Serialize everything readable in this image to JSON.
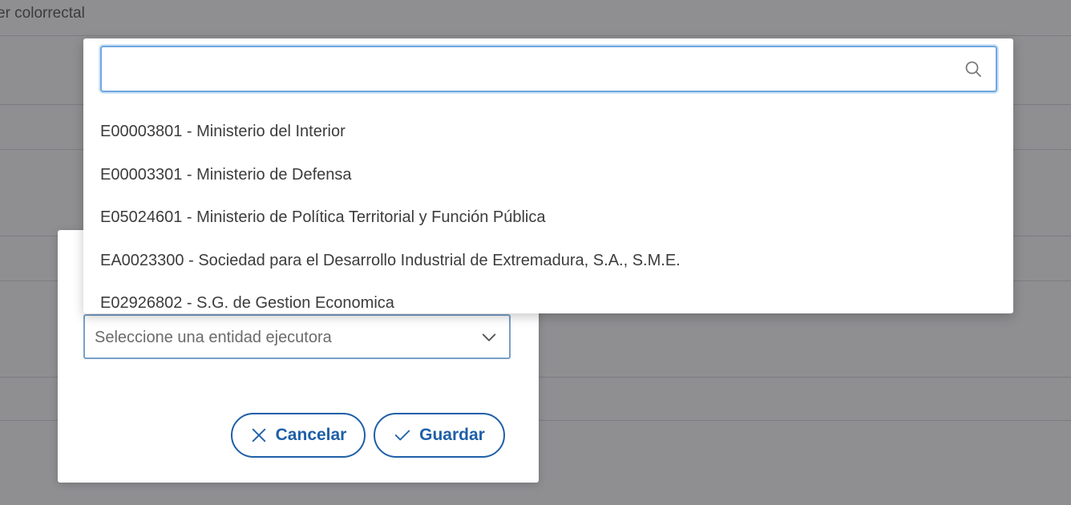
{
  "background": {
    "text": "er colorrectal"
  },
  "modal": {
    "select": {
      "placeholder": "Seleccione una entidad ejecutora",
      "chevron_icon": "chevron-down-icon"
    },
    "buttons": {
      "cancel_label": "Cancelar",
      "cancel_icon": "close-icon",
      "save_label": "Guardar",
      "save_icon": "check-icon"
    }
  },
  "dropdown": {
    "search": {
      "value": "",
      "placeholder": "",
      "icon": "search-icon"
    },
    "options": [
      "E00003801 - Ministerio del Interior",
      "E00003301 - Ministerio de Defensa",
      "E05024601 - Ministerio de Política Territorial y Función Pública",
      "EA0023300 - Sociedad para el Desarrollo Industrial de Extremadura, S.A., S.M.E.",
      "E02926802 - S.G. de Gestion Economica"
    ]
  },
  "colors": {
    "accent": "#1f5fa8",
    "overlay": "#8f8f92",
    "focus_border": "#6fa7df"
  }
}
